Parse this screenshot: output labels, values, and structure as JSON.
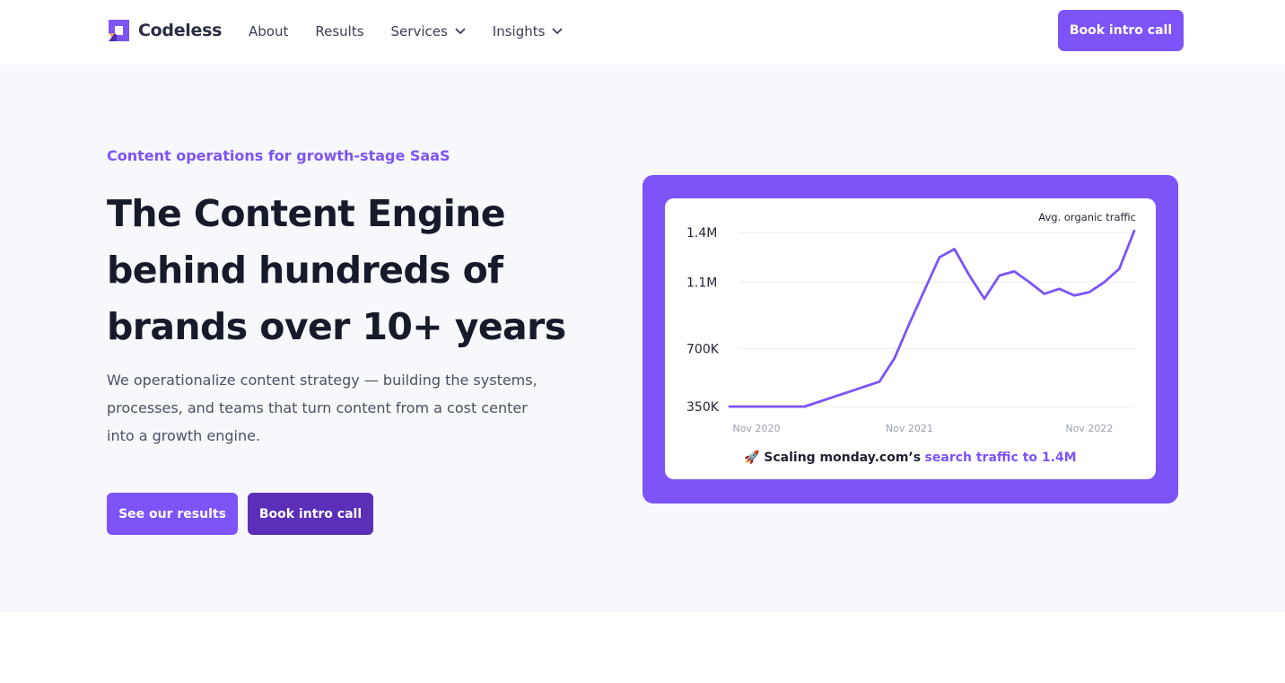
{
  "header": {
    "logo_text": "Codeless",
    "nav": [
      {
        "label": "About"
      },
      {
        "label": "Results"
      },
      {
        "label": "Services"
      },
      {
        "label": "Insights"
      }
    ],
    "cta_label": "Book intro call"
  },
  "hero": {
    "kicker": "Content operations for growth-stage SaaS",
    "headline_lines": [
      "The Content Engine",
      "behind hundreds of",
      "brands over 10+ years"
    ],
    "lead_lines": [
      "We operationalize content strategy — building the systems,",
      "processes, and teams that turn content from a cost center",
      "into a growth engine."
    ],
    "primary_cta": "See our results",
    "secondary_cta": "Book intro call"
  },
  "colors": {
    "accent": "#7c54f8",
    "accent_dark": "#5b2fb8",
    "hero_bg": "#f6f8fb",
    "text_dark": "#161a2b"
  },
  "chart_card": {
    "caption_emoji": "🚀",
    "caption_prefix": "Scaling monday.com’s",
    "caption_highlight": "search traffic to 1.4M"
  },
  "chart_data": {
    "type": "line",
    "title": "Avg. organic traffic",
    "xlabel": "",
    "ylabel": "",
    "x_ticks": [
      "Nov 2020",
      "Nov 2021",
      "Nov 2022"
    ],
    "y_ticks": [
      {
        "label": "1.4M",
        "value": 1400000
      },
      {
        "label": "1.1M",
        "value": 1100000
      },
      {
        "label": "700K",
        "value": 700000
      },
      {
        "label": "350K",
        "value": 350000
      }
    ],
    "ylim": [
      350000,
      1400000
    ],
    "grid": true,
    "series": [
      {
        "color": "#7c54f8",
        "x": [
          "2020-11",
          "2020-12",
          "2021-01",
          "2021-02",
          "2021-03",
          "2021-04",
          "2021-05",
          "2021-06",
          "2021-07",
          "2021-08",
          "2021-09",
          "2021-10",
          "2021-11",
          "2021-12",
          "2022-01",
          "2022-02",
          "2022-03",
          "2022-04",
          "2022-05",
          "2022-06",
          "2022-07",
          "2022-08",
          "2022-09",
          "2022-10",
          "2022-11",
          "2022-12",
          "2023-01",
          "2023-02"
        ],
        "values": [
          350000,
          350000,
          350000,
          350000,
          350000,
          350000,
          380000,
          410000,
          440000,
          470000,
          500000,
          640000,
          850000,
          1050000,
          1250000,
          1300000,
          1140000,
          1000000,
          1140000,
          1165000,
          1100000,
          1030000,
          1060000,
          1020000,
          1040000,
          1100000,
          1180000,
          1410000
        ]
      }
    ]
  }
}
